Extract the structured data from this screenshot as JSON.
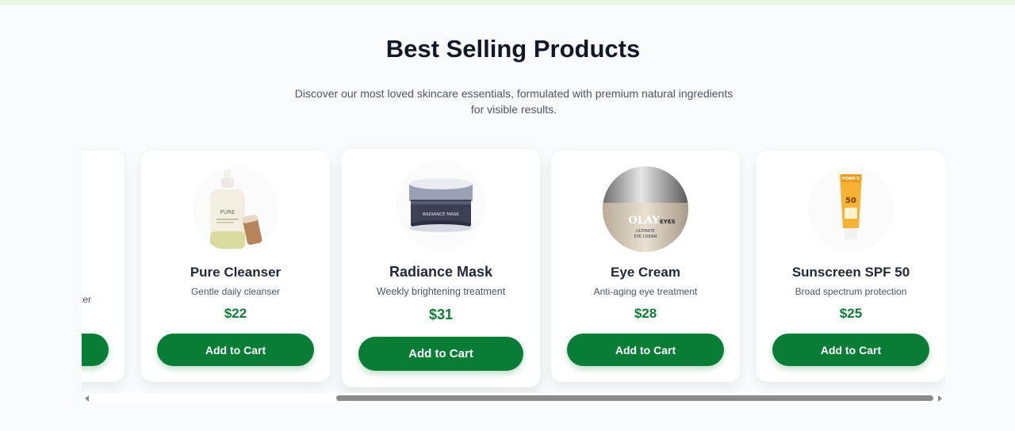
{
  "section": {
    "title": "Best Selling Products",
    "subtitle": "Discover our most loved skincare essentials, formulated with premium natural ingredients for visible results."
  },
  "products": [
    {
      "name": "",
      "description": "…zer",
      "price": "",
      "button_label": ""
    },
    {
      "name": "Pure Cleanser",
      "description": "Gentle daily cleanser",
      "price": "$22",
      "button_label": "Add to Cart",
      "image_text": "PURE",
      "image_icon": "cleanser-bottle-icon"
    },
    {
      "name": "Radiance Mask",
      "description": "Weekly brightening treatment",
      "price": "$31",
      "button_label": "Add to Cart",
      "image_text": "RADIANCE MASK",
      "image_icon": "mask-jar-icon"
    },
    {
      "name": "Eye Cream",
      "description": "Anti-aging eye treatment",
      "price": "$28",
      "button_label": "Add to Cart",
      "image_text": [
        "OLAY",
        "EYES",
        "ULTIMATE",
        "EYE CREAM"
      ],
      "image_icon": "eye-cream-jar-icon"
    },
    {
      "name": "Sunscreen SPF 50",
      "description": "Broad spectrum protection",
      "price": "$25",
      "button_label": "Add to Cart",
      "image_text": [
        "POND'S",
        "50"
      ],
      "image_icon": "sunscreen-tube-icon"
    }
  ],
  "theme": {
    "accent": "#087d35",
    "price_color": "#0c7d33",
    "background": "#f8fafc",
    "top_strip": "#eaf6e6"
  }
}
